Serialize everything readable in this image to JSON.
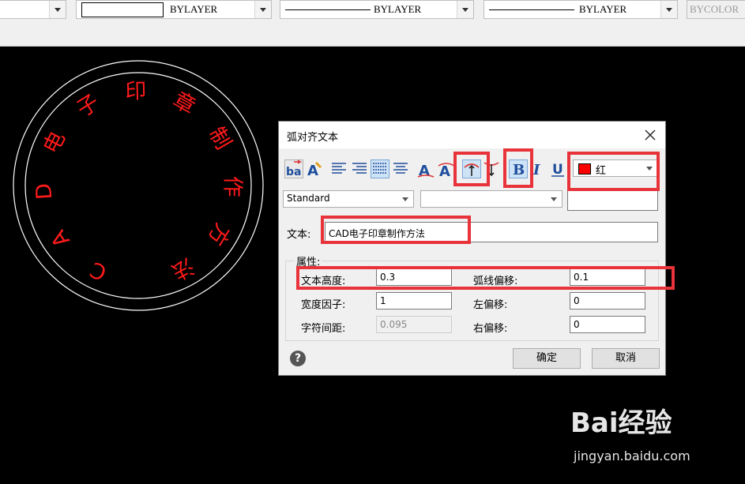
{
  "toolbar": {
    "linetype_label": "BYLAYER",
    "lineweight_label": "BYLAYER",
    "linestyle_label": "BYLAYER",
    "color_label": "BYCOLOR"
  },
  "seal": {
    "text": "CAD电子印章制作方法",
    "text_color": "#ff1a1a",
    "circle_color": "#ffffff"
  },
  "dialog": {
    "title": "弧对齐文本",
    "color_value": "红",
    "color_swatch": "#ff0000",
    "style_value": "Standard",
    "font_value": "",
    "text_label": "文本:",
    "text_value": "CAD电子印章制作方法",
    "group_label": "属性:",
    "props": {
      "text_height_label": "文本高度:",
      "text_height_value": "0.3",
      "arc_offset_label": "弧线偏移:",
      "arc_offset_value": "0.1",
      "width_factor_label": "宽度因子:",
      "width_factor_value": "1",
      "left_offset_label": "左偏移:",
      "left_offset_value": "0",
      "char_spacing_label": "字符间距:",
      "char_spacing_value": "0.095",
      "right_offset_label": "右偏移:",
      "right_offset_value": "0"
    },
    "ok_label": "确定",
    "cancel_label": "取消",
    "help_glyph": "?"
  },
  "watermark": {
    "logo": "Bai经验",
    "url": "jingyan.baidu.com"
  },
  "colors": {
    "highlight": "#e8333a"
  }
}
